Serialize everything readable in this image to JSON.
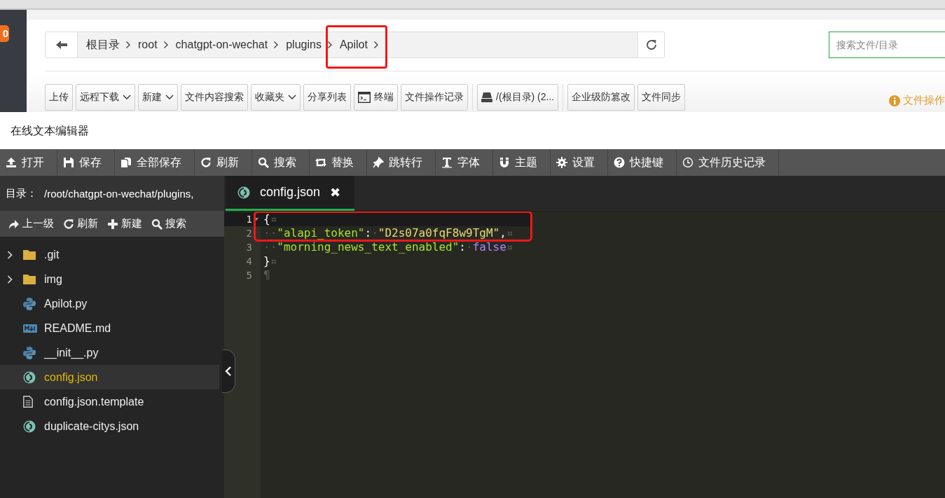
{
  "side_badge": "0",
  "breadcrumb": {
    "items": [
      {
        "label": "根目录",
        "highlighted": false
      },
      {
        "label": "root",
        "highlighted": false
      },
      {
        "label": "chatgpt-on-wechat",
        "highlighted": false
      },
      {
        "label": "plugins",
        "highlighted": false
      },
      {
        "label": "Apilot",
        "highlighted": true
      }
    ]
  },
  "file_search": {
    "placeholder": "搜索文件/目录"
  },
  "toolbar": [
    [
      {
        "label": "上传",
        "dropdown": false
      },
      {
        "label": "远程下载",
        "dropdown": true
      },
      {
        "label": "新建",
        "dropdown": true
      },
      {
        "label": "文件内容搜索",
        "dropdown": false
      },
      {
        "label": "收藏夹",
        "dropdown": true
      },
      {
        "label": "分享列表",
        "dropdown": false
      },
      {
        "label": "终端",
        "dropdown": false,
        "kind": "terminal"
      },
      {
        "label": "文件操作记录",
        "dropdown": false
      }
    ],
    [
      {
        "label": "/(根目录) (2...",
        "dropdown": false,
        "kind": "drive"
      }
    ],
    [
      {
        "label": "企业级防篡改",
        "dropdown": false
      },
      {
        "label": "文件同步",
        "dropdown": false
      }
    ]
  ],
  "notice": "文件操作",
  "editor": {
    "title": "在线文本编辑器",
    "toolbar": [
      "打开",
      "保存",
      "全部保存",
      "刷新",
      "搜索",
      "替换",
      "跳转行",
      "字体",
      "主题",
      "设置",
      "快捷键",
      "文件历史记录"
    ],
    "directory_label": "目录：",
    "directory_path": "/root/chatgpt-on-wechat/plugins,",
    "sidebar_actions": [
      "上一级",
      "刷新",
      "新建",
      "搜索"
    ],
    "files": [
      {
        "name": ".git",
        "kind": "folder",
        "expanded": false,
        "selected": false
      },
      {
        "name": "img",
        "kind": "folder",
        "expanded": false,
        "selected": false
      },
      {
        "name": "Apilot.py",
        "kind": "python",
        "selected": false
      },
      {
        "name": "README.md",
        "kind": "markdown",
        "selected": false
      },
      {
        "name": "__init__.py",
        "kind": "python",
        "selected": false
      },
      {
        "name": "config.json",
        "kind": "json",
        "selected": true
      },
      {
        "name": "config.json.template",
        "kind": "text",
        "selected": false
      },
      {
        "name": "duplicate-citys.json",
        "kind": "json",
        "selected": false
      }
    ],
    "tabs": [
      {
        "label": "config.json",
        "kind": "json",
        "selected": true,
        "close": "✖"
      }
    ],
    "lines": [
      {
        "number": "1",
        "foldable": true,
        "active": true,
        "highlighted": true,
        "tokens": [
          {
            "kind": "punct",
            "text": "{"
          },
          {
            "kind": "invisible",
            "text": "¤"
          }
        ]
      },
      {
        "number": "2",
        "foldable": false,
        "active": false,
        "highlighted": true,
        "tokens": [
          {
            "kind": "invisible",
            "text": "··"
          },
          {
            "kind": "key",
            "text": "\"alapi_token\""
          },
          {
            "kind": "punct",
            "text": ":"
          },
          {
            "kind": "invisible",
            "text": "·"
          },
          {
            "kind": "string",
            "text": "\"D2s07a0fqF8w9TgM\""
          },
          {
            "kind": "punct",
            "text": ","
          },
          {
            "kind": "invisible",
            "text": "¤"
          }
        ]
      },
      {
        "number": "3",
        "foldable": false,
        "active": false,
        "highlighted": false,
        "tokens": [
          {
            "kind": "invisible",
            "text": "··"
          },
          {
            "kind": "key",
            "text": "\"morning_news_text_enabled\""
          },
          {
            "kind": "punct",
            "text": ":"
          },
          {
            "kind": "invisible",
            "text": "·"
          },
          {
            "kind": "bool",
            "text": "false"
          },
          {
            "kind": "invisible",
            "text": "¤"
          }
        ]
      },
      {
        "number": "4",
        "foldable": false,
        "active": false,
        "highlighted": false,
        "tokens": [
          {
            "kind": "punct",
            "text": "}"
          },
          {
            "kind": "invisible",
            "text": "¤"
          }
        ]
      },
      {
        "number": "5",
        "foldable": false,
        "active": false,
        "highlighted": false,
        "tokens": [
          {
            "kind": "invisible",
            "text": "¶"
          }
        ]
      }
    ]
  }
}
